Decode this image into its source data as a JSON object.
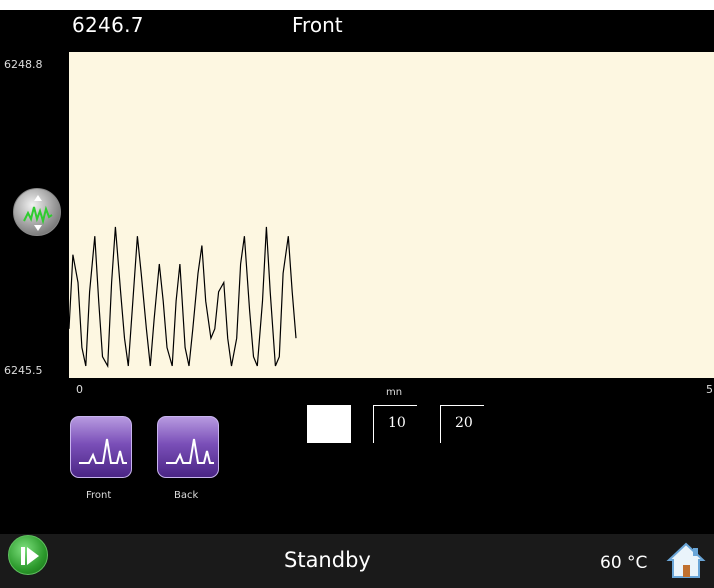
{
  "header": {
    "readout": "6246.7",
    "channel_title": "Front"
  },
  "plot": {
    "y_max_label": "6248.8",
    "y_min_label": "6245.5",
    "x_min_label": "0",
    "x_max_label": "5",
    "x_unit_label": "mn",
    "background": "#fdf7e1",
    "trace_color": "#000000"
  },
  "chart_data": {
    "type": "line",
    "ylim": [
      6245.5,
      6248.8
    ],
    "xlim": [
      0,
      5
    ],
    "series": [
      {
        "x": [
          0,
          0.03,
          0.07,
          0.1,
          0.13,
          0.16,
          0.2,
          0.23,
          0.26,
          0.3,
          0.33,
          0.36,
          0.4,
          0.43,
          0.46,
          0.5,
          0.53,
          0.56,
          0.6,
          0.63,
          0.66,
          0.7,
          0.73,
          0.76,
          0.8,
          0.83,
          0.86,
          0.9,
          0.93,
          0.96,
          1.0,
          1.03,
          1.06,
          1.1,
          1.13,
          1.16,
          1.2,
          1.23,
          1.26,
          1.3,
          1.33,
          1.36,
          1.4,
          1.43,
          1.46,
          1.5,
          1.53,
          1.56,
          1.6,
          1.63,
          1.66,
          1.7,
          1.73,
          1.76
        ],
        "y": [
          6245.9,
          6246.7,
          6246.4,
          6245.7,
          6245.5,
          6246.3,
          6246.9,
          6246.2,
          6245.6,
          6245.5,
          6246.4,
          6247.0,
          6246.3,
          6245.8,
          6245.5,
          6246.3,
          6246.9,
          6246.5,
          6245.9,
          6245.5,
          6246.0,
          6246.6,
          6246.2,
          6245.7,
          6245.5,
          6246.2,
          6246.6,
          6245.7,
          6245.5,
          6245.9,
          6246.5,
          6246.8,
          6246.2,
          6245.8,
          6245.9,
          6246.3,
          6246.4,
          6245.8,
          6245.5,
          6245.8,
          6246.6,
          6246.9,
          6246.1,
          6245.6,
          6245.5,
          6246.2,
          6247.0,
          6246.3,
          6245.5,
          6245.6,
          6246.5,
          6246.9,
          6246.3,
          6245.8
        ]
      }
    ]
  },
  "controls": {
    "front_label": "Front",
    "back_label": "Back",
    "scale_a": "10",
    "scale_b": "20"
  },
  "status": {
    "text": "Standby",
    "temperature": "60 °C",
    "accent_green": "#2c9a2c",
    "accent_purple": "#7a4fb8"
  },
  "icons": {
    "zoom": "zoom-vertical-icon",
    "front": "chromatogram-icon",
    "back": "chromatogram-icon",
    "play": "play-next-icon",
    "home": "home-icon"
  }
}
